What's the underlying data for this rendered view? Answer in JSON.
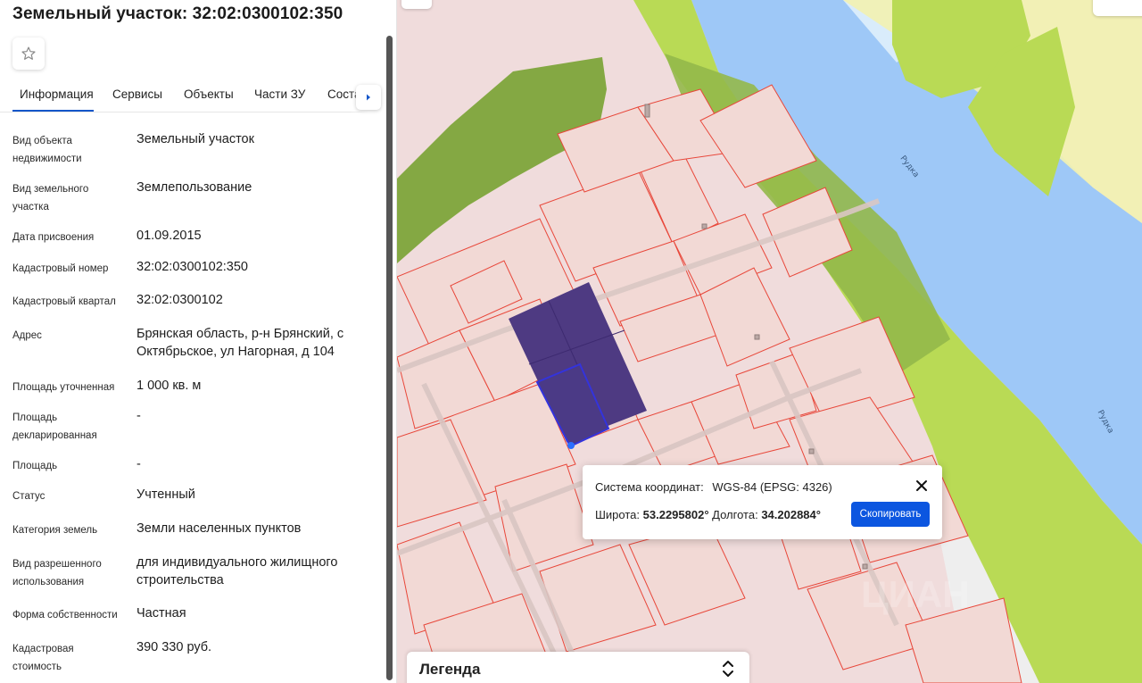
{
  "title": "Земельный участок: 32:02:0300102:350",
  "tabs": [
    {
      "label": "Информация"
    },
    {
      "label": "Сервисы"
    },
    {
      "label": "Объекты"
    },
    {
      "label": "Части ЗУ"
    },
    {
      "label": "Соста"
    }
  ],
  "properties": [
    {
      "label": "Вид объекта недвижимости",
      "value": "Земельный участок"
    },
    {
      "label": "Вид земельного участка",
      "value": "Землепользование"
    },
    {
      "label": "Дата присвоения",
      "value": "01.09.2015"
    },
    {
      "label": "Кадастровый номер",
      "value": "32:02:0300102:350"
    },
    {
      "label": "Кадастровый квартал",
      "value": "32:02:0300102"
    },
    {
      "label": "Адрес",
      "value": "Брянская область, р-н Брянский, с Октябрьское, ул Нагорная, д 104"
    },
    {
      "label": "Площадь уточненная",
      "value": "1 000 кв. м"
    },
    {
      "label": "Площадь декларированная",
      "value": "-"
    },
    {
      "label": "Площадь",
      "value": "-"
    },
    {
      "label": "Статус",
      "value": "Учтенный"
    },
    {
      "label": "Категория земель",
      "value": "Земли населенных пунктов"
    },
    {
      "label": "Вид разрешенного использования",
      "value": "для индивидуального жилищного строительства"
    },
    {
      "label": "Форма собственности",
      "value": "Частная"
    },
    {
      "label": "Кадастровая стоимость",
      "value": "390 330 руб."
    }
  ],
  "map": {
    "river_label_1": "Рудка",
    "river_label_2": "Рудка",
    "watermark": "ЦИАН"
  },
  "popup": {
    "crs_label": "Система координат:",
    "crs_value": "WGS-84 (EPSG: 4326)",
    "lat_label": "Широта:",
    "lat_value": "53.2295802°",
    "lon_label": "Долгота:",
    "lon_value": "34.202884°",
    "copy_label": "Скопировать"
  },
  "legend": {
    "title": "Легенда"
  },
  "colors": {
    "accent": "#0c56e0",
    "selected_parcel": "#4e3a82",
    "parcel_fill": "#f2d9d5",
    "parcel_border": "#e8473a",
    "river": "#9ec8f7",
    "forest": "#84a843",
    "meadow": "#b9da55"
  }
}
